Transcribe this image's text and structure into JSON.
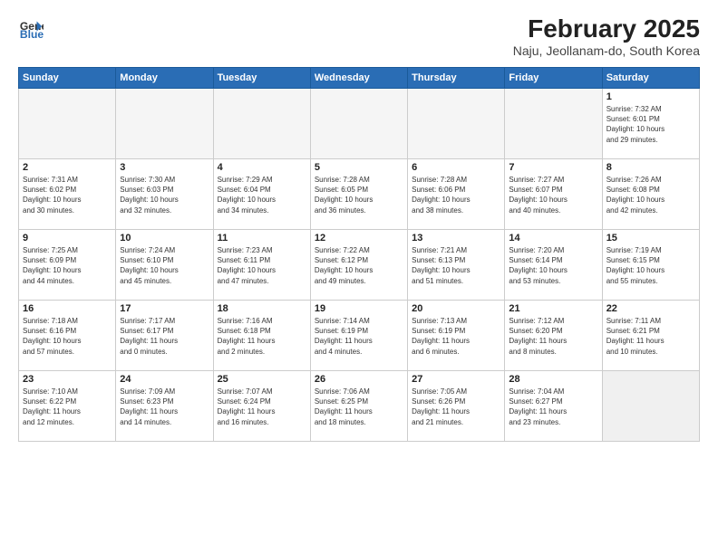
{
  "header": {
    "logo_line1": "General",
    "logo_line2": "Blue",
    "title": "February 2025",
    "subtitle": "Naju, Jeollanam-do, South Korea"
  },
  "weekdays": [
    "Sunday",
    "Monday",
    "Tuesday",
    "Wednesday",
    "Thursday",
    "Friday",
    "Saturday"
  ],
  "weeks": [
    [
      {
        "day": "",
        "info": ""
      },
      {
        "day": "",
        "info": ""
      },
      {
        "day": "",
        "info": ""
      },
      {
        "day": "",
        "info": ""
      },
      {
        "day": "",
        "info": ""
      },
      {
        "day": "",
        "info": ""
      },
      {
        "day": "1",
        "info": "Sunrise: 7:32 AM\nSunset: 6:01 PM\nDaylight: 10 hours\nand 29 minutes."
      }
    ],
    [
      {
        "day": "2",
        "info": "Sunrise: 7:31 AM\nSunset: 6:02 PM\nDaylight: 10 hours\nand 30 minutes."
      },
      {
        "day": "3",
        "info": "Sunrise: 7:30 AM\nSunset: 6:03 PM\nDaylight: 10 hours\nand 32 minutes."
      },
      {
        "day": "4",
        "info": "Sunrise: 7:29 AM\nSunset: 6:04 PM\nDaylight: 10 hours\nand 34 minutes."
      },
      {
        "day": "5",
        "info": "Sunrise: 7:28 AM\nSunset: 6:05 PM\nDaylight: 10 hours\nand 36 minutes."
      },
      {
        "day": "6",
        "info": "Sunrise: 7:28 AM\nSunset: 6:06 PM\nDaylight: 10 hours\nand 38 minutes."
      },
      {
        "day": "7",
        "info": "Sunrise: 7:27 AM\nSunset: 6:07 PM\nDaylight: 10 hours\nand 40 minutes."
      },
      {
        "day": "8",
        "info": "Sunrise: 7:26 AM\nSunset: 6:08 PM\nDaylight: 10 hours\nand 42 minutes."
      }
    ],
    [
      {
        "day": "9",
        "info": "Sunrise: 7:25 AM\nSunset: 6:09 PM\nDaylight: 10 hours\nand 44 minutes."
      },
      {
        "day": "10",
        "info": "Sunrise: 7:24 AM\nSunset: 6:10 PM\nDaylight: 10 hours\nand 45 minutes."
      },
      {
        "day": "11",
        "info": "Sunrise: 7:23 AM\nSunset: 6:11 PM\nDaylight: 10 hours\nand 47 minutes."
      },
      {
        "day": "12",
        "info": "Sunrise: 7:22 AM\nSunset: 6:12 PM\nDaylight: 10 hours\nand 49 minutes."
      },
      {
        "day": "13",
        "info": "Sunrise: 7:21 AM\nSunset: 6:13 PM\nDaylight: 10 hours\nand 51 minutes."
      },
      {
        "day": "14",
        "info": "Sunrise: 7:20 AM\nSunset: 6:14 PM\nDaylight: 10 hours\nand 53 minutes."
      },
      {
        "day": "15",
        "info": "Sunrise: 7:19 AM\nSunset: 6:15 PM\nDaylight: 10 hours\nand 55 minutes."
      }
    ],
    [
      {
        "day": "16",
        "info": "Sunrise: 7:18 AM\nSunset: 6:16 PM\nDaylight: 10 hours\nand 57 minutes."
      },
      {
        "day": "17",
        "info": "Sunrise: 7:17 AM\nSunset: 6:17 PM\nDaylight: 11 hours\nand 0 minutes."
      },
      {
        "day": "18",
        "info": "Sunrise: 7:16 AM\nSunset: 6:18 PM\nDaylight: 11 hours\nand 2 minutes."
      },
      {
        "day": "19",
        "info": "Sunrise: 7:14 AM\nSunset: 6:19 PM\nDaylight: 11 hours\nand 4 minutes."
      },
      {
        "day": "20",
        "info": "Sunrise: 7:13 AM\nSunset: 6:19 PM\nDaylight: 11 hours\nand 6 minutes."
      },
      {
        "day": "21",
        "info": "Sunrise: 7:12 AM\nSunset: 6:20 PM\nDaylight: 11 hours\nand 8 minutes."
      },
      {
        "day": "22",
        "info": "Sunrise: 7:11 AM\nSunset: 6:21 PM\nDaylight: 11 hours\nand 10 minutes."
      }
    ],
    [
      {
        "day": "23",
        "info": "Sunrise: 7:10 AM\nSunset: 6:22 PM\nDaylight: 11 hours\nand 12 minutes."
      },
      {
        "day": "24",
        "info": "Sunrise: 7:09 AM\nSunset: 6:23 PM\nDaylight: 11 hours\nand 14 minutes."
      },
      {
        "day": "25",
        "info": "Sunrise: 7:07 AM\nSunset: 6:24 PM\nDaylight: 11 hours\nand 16 minutes."
      },
      {
        "day": "26",
        "info": "Sunrise: 7:06 AM\nSunset: 6:25 PM\nDaylight: 11 hours\nand 18 minutes."
      },
      {
        "day": "27",
        "info": "Sunrise: 7:05 AM\nSunset: 6:26 PM\nDaylight: 11 hours\nand 21 minutes."
      },
      {
        "day": "28",
        "info": "Sunrise: 7:04 AM\nSunset: 6:27 PM\nDaylight: 11 hours\nand 23 minutes."
      },
      {
        "day": "",
        "info": ""
      }
    ]
  ]
}
